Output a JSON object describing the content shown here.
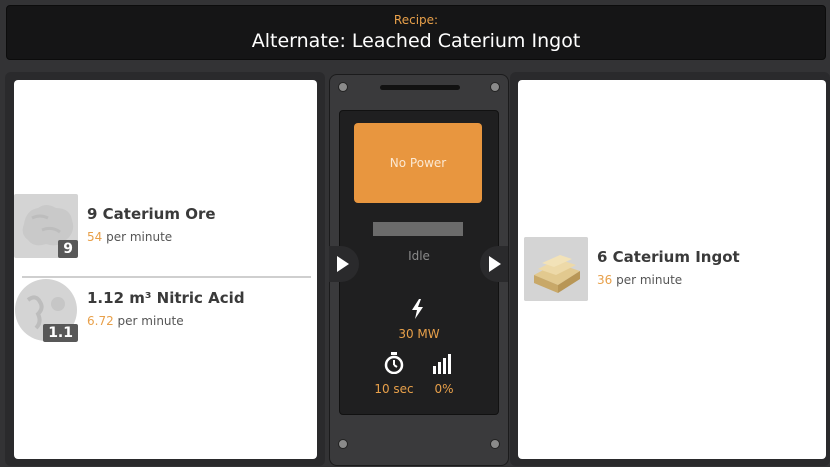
{
  "header": {
    "label": "Recipe:",
    "title": "Alternate: Leached Caterium Ingot"
  },
  "inputs": [
    {
      "name": "9 Caterium Ore",
      "badge": "9",
      "rate": "54",
      "rate_unit": "per minute",
      "icon": "caterium-ore-icon"
    },
    {
      "name": "1.12 m³ Nitric Acid",
      "badge": "1.1",
      "rate": "6.72",
      "rate_unit": "per minute",
      "icon": "nitric-acid-icon"
    }
  ],
  "machine": {
    "power_button": "No Power",
    "status": "Idle",
    "power": "30 MW",
    "time": "10 sec",
    "productivity": "0%"
  },
  "outputs": [
    {
      "name": "6 Caterium Ingot",
      "rate": "36",
      "rate_unit": "per minute",
      "icon": "caterium-ingot-icon"
    }
  ],
  "colors": {
    "accent": "#e8a04a",
    "button": "#e8963f",
    "panel": "#2a2a2c"
  }
}
